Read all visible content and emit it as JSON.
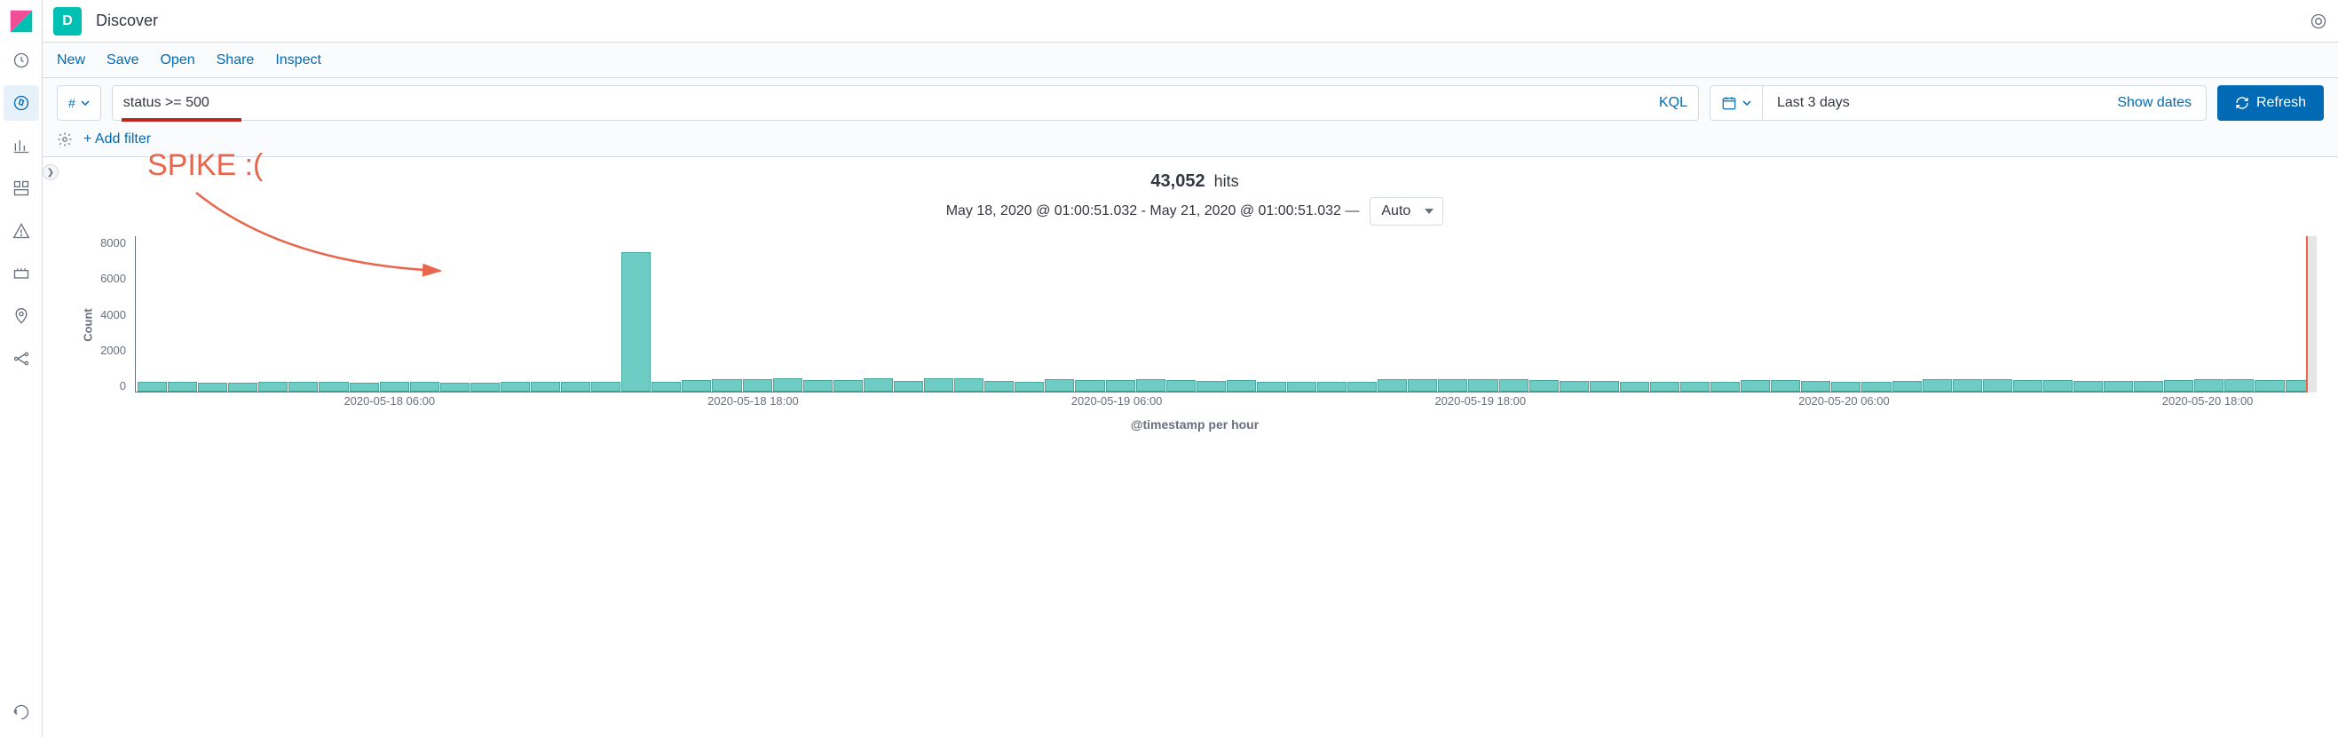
{
  "header": {
    "space_initial": "D",
    "title": "Discover"
  },
  "submenu": {
    "new": "New",
    "save": "Save",
    "open": "Open",
    "share": "Share",
    "inspect": "Inspect"
  },
  "query": {
    "value": "status >= 500",
    "lang": "KQL"
  },
  "datepicker": {
    "text": "Last 3 days",
    "show_dates": "Show dates"
  },
  "refresh_label": "Refresh",
  "add_filter": "+ Add filter",
  "hits": {
    "count": "43,052",
    "label": "hits"
  },
  "time_range": "May 18, 2020 @ 01:00:51.032 - May 21, 2020 @ 01:00:51.032 —",
  "interval": "Auto",
  "annotation": "SPIKE :(",
  "chart_data": {
    "type": "bar",
    "title": "",
    "xlabel": "@timestamp per hour",
    "ylabel": "Count",
    "ylim": [
      0,
      8000
    ],
    "y_ticks": [
      8000,
      6000,
      4000,
      2000,
      0
    ],
    "x_tick_labels": [
      "2020-05-18 06:00",
      "2020-05-18 18:00",
      "2020-05-19 06:00",
      "2020-05-19 18:00",
      "2020-05-20 06:00",
      "2020-05-20 18:00"
    ],
    "values": [
      500,
      500,
      480,
      480,
      500,
      520,
      500,
      480,
      500,
      500,
      480,
      480,
      500,
      500,
      500,
      500,
      7200,
      500,
      600,
      650,
      640,
      700,
      600,
      580,
      700,
      560,
      700,
      700,
      540,
      520,
      620,
      600,
      600,
      620,
      600,
      560,
      580,
      520,
      500,
      500,
      500,
      640,
      660,
      660,
      640,
      640,
      600,
      560,
      540,
      520,
      520,
      520,
      520,
      580,
      600,
      540,
      500,
      520,
      540,
      620,
      640,
      620,
      600,
      580,
      560,
      540,
      540,
      600,
      640,
      640,
      600,
      600
    ]
  }
}
